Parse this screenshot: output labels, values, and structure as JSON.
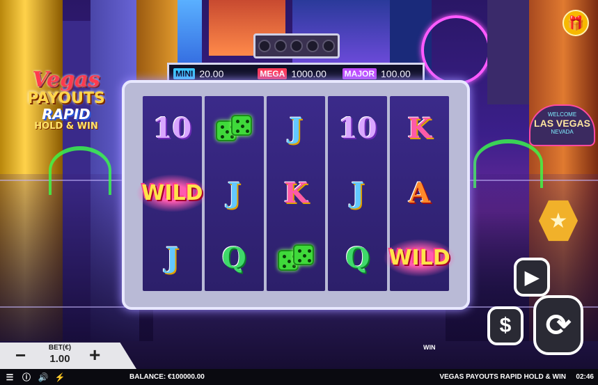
{
  "game": {
    "logo": {
      "line1": "Vegas",
      "line2": "PAYOUTS",
      "line3": "RAPID",
      "line4": "HOLD & WIN"
    },
    "name": "VEGAS PAYOUTS RAPID HOLD & WIN"
  },
  "jackpots": [
    {
      "label": "MINI",
      "value": "20.00",
      "color": "#3ac8ff"
    },
    {
      "label": "MEGA",
      "value": "1000.00",
      "color": "#ff3a5a"
    },
    {
      "label": "MAJOR",
      "value": "100.00",
      "color": "#c04aff"
    }
  ],
  "reels": [
    [
      "10",
      "WILD",
      "J"
    ],
    [
      "DICE",
      "J",
      "Q"
    ],
    [
      "J",
      "K",
      "DICE"
    ],
    [
      "10",
      "J",
      "Q"
    ],
    [
      "K",
      "A",
      "WILD"
    ]
  ],
  "decor": {
    "sign_welcome": "WELCOME",
    "sign_main": "LAS VEGAS",
    "sign_sub": "NEVADA"
  },
  "controls": {
    "bet_label": "BET(€)",
    "bet_value": "1.00",
    "minus": "−",
    "plus": "+",
    "win_label": "WIN",
    "balance": "BALANCE: €100000.00",
    "clock": "02:46",
    "cash_symbol": "$"
  },
  "icons": [
    "menu-icon",
    "info-icon",
    "sound-icon",
    "turbo-icon",
    "gift-icon",
    "star-icon",
    "play-icon",
    "dollar-icon",
    "spin-icon"
  ]
}
